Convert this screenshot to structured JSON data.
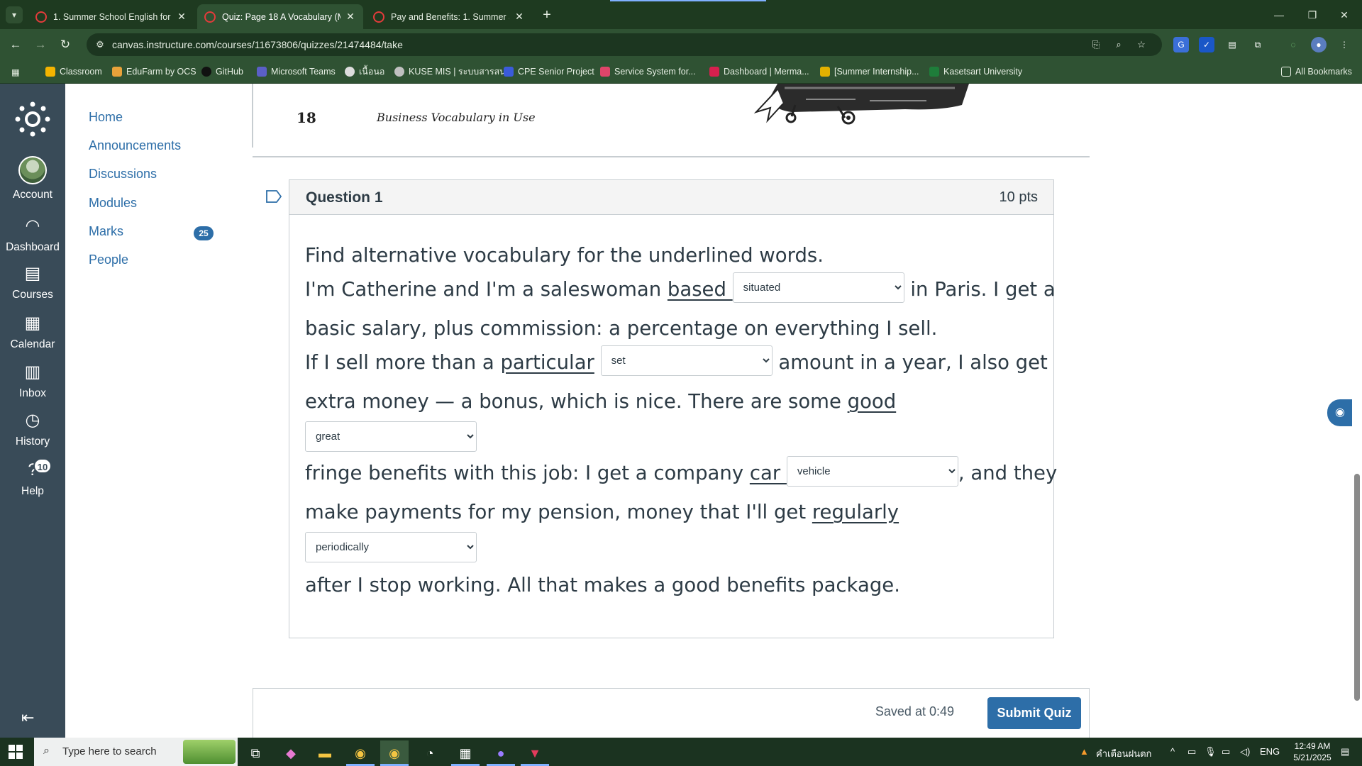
{
  "browser": {
    "tabs": [
      {
        "title": "1. Summer School English for Jo",
        "active": false
      },
      {
        "title": "Quiz: Page 18 A Vocabulary (M",
        "active": true
      },
      {
        "title": "Pay and Benefits: 1. Summer Sc",
        "active": false
      }
    ],
    "url": "canvas.instructure.com/courses/11673806/quizzes/21474484/take",
    "bookmarks": [
      "Classroom",
      "EduFarm by OCS",
      "GitHub",
      "Microsoft Teams",
      "เนื้อนอ",
      "KUSE MIS | ระบบสารสน...",
      "CPE Senior Project",
      "Service System for...",
      "Dashboard | Merma...",
      "[Summer Internship...",
      "Kasetsart University"
    ],
    "all_bookmarks": "All Bookmarks"
  },
  "global_nav": {
    "account": "Account",
    "dashboard": "Dashboard",
    "courses": "Courses",
    "calendar": "Calendar",
    "inbox": "Inbox",
    "history": "History",
    "help": "Help",
    "help_badge": "10"
  },
  "course_nav": {
    "links": [
      "Home",
      "Announcements",
      "Discussions",
      "Modules",
      "Marks",
      "People"
    ],
    "marks_badge": "25"
  },
  "scan": {
    "page_number": "18",
    "book_title": "Business Vocabulary in Use"
  },
  "question": {
    "name": "Question 1",
    "points": "10 pts",
    "instruction": "Find alternative vocabulary for the underlined words.",
    "seg1": "I'm Catherine and I'm a saleswoman ",
    "u1": "based ",
    "sel1": "situated",
    "seg2": " in Paris. I get a",
    "seg3": "basic salary, plus commission: a percentage on everything I sell.",
    "seg4": "If I sell more than a ",
    "u2": "particular",
    "sel2": "set",
    "seg5": " amount in a year, I also get",
    "seg6": "extra money — a bonus, which is nice. There are some ",
    "u3": "good",
    "sel3": "great",
    "seg7": "fringe benefits with this job: I get a company ",
    "u4": "car ",
    "sel4": "vehicle",
    "seg8": ", and they",
    "seg9": "make payments for my pension, money that I'll get ",
    "u5": "regularly",
    "sel5": "periodically",
    "seg10": "after I stop working. All that makes a good benefits package."
  },
  "footer": {
    "saved": "Saved at 0:49",
    "submit": "Submit Quiz"
  },
  "taskbar": {
    "search_placeholder": "Type here to search",
    "weather": "คำเตือนฝนตก",
    "language": "ENG",
    "time": "12:49 AM",
    "date": "5/21/2025"
  },
  "colors": {
    "canvas_nav": "#394b58",
    "link_blue": "#2d6ea8",
    "browser_green": "#2f5233"
  }
}
